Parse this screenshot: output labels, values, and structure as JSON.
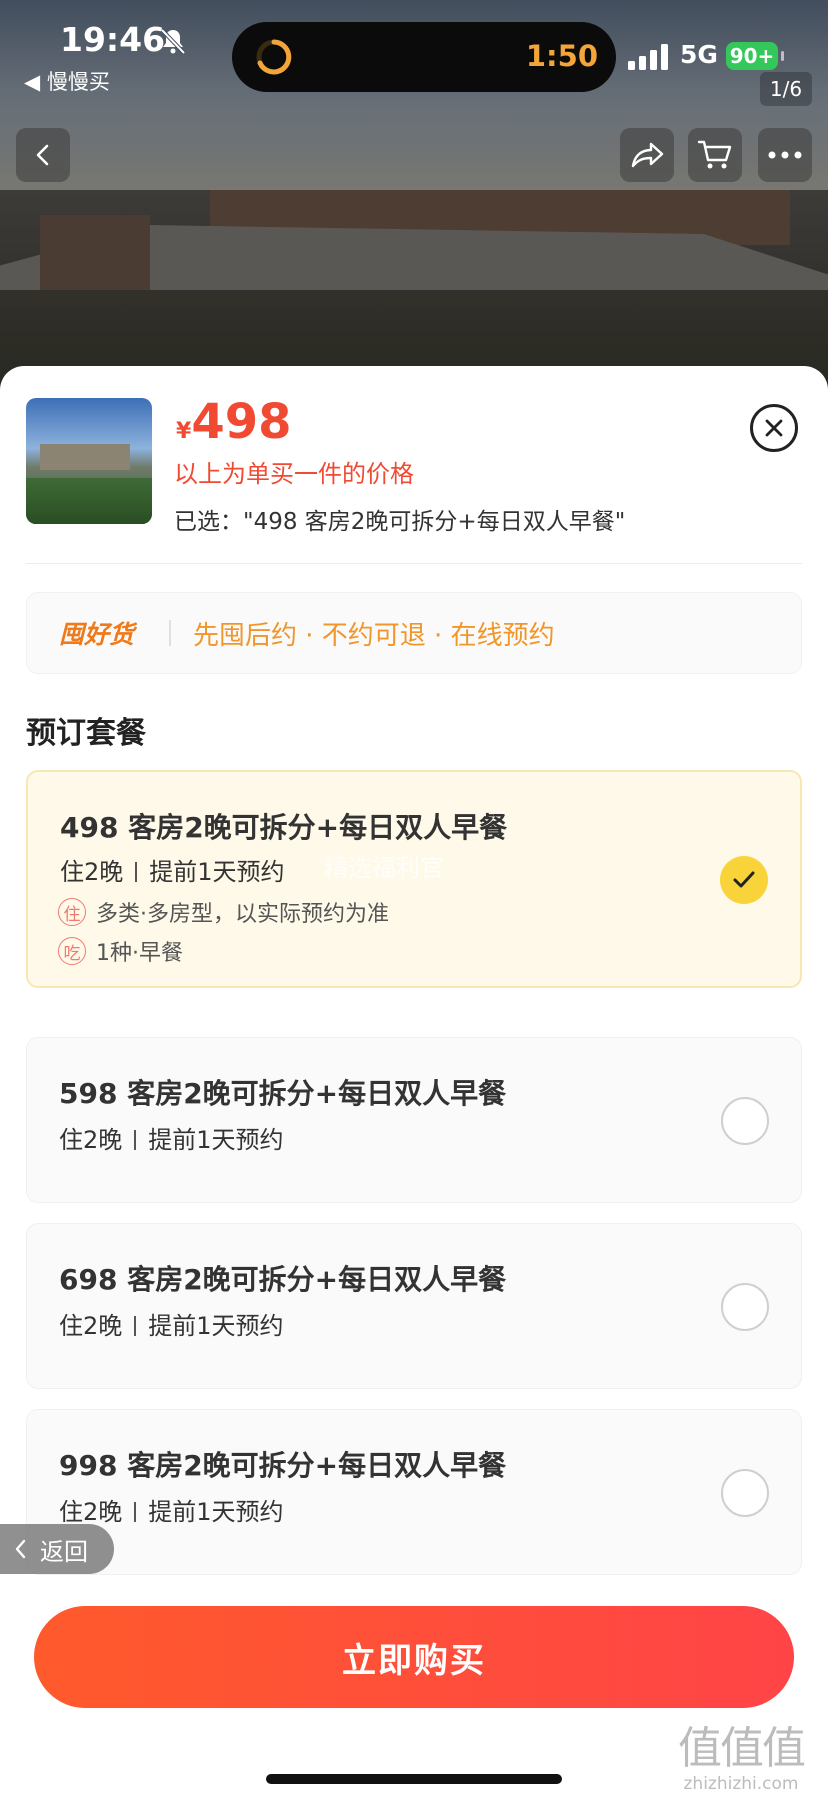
{
  "status_bar": {
    "time": "19:46",
    "back_app": "◀ 慢慢买",
    "island_timer": "1:50",
    "network": "5G",
    "battery": "90+"
  },
  "gallery": {
    "pager": "1/6"
  },
  "sheet": {
    "currency": "¥",
    "price": "498",
    "single_note": "以上为单买一件的价格",
    "selected_text": "已选：\"498 客房2晚可拆分+每日双人早餐\"",
    "promo": {
      "brand": "囤好货",
      "text": "先囤后约 · 不约可退 · 在线预约"
    },
    "section_title": "预订套餐",
    "watermark": "精选福利官",
    "packages": [
      {
        "title": "498 客房2晚可拆分+每日双人早餐",
        "nights": "住2晚",
        "advance": "提前1天预约",
        "selected": true,
        "tags": [
          {
            "badge": "住",
            "text": "多类·多房型，以实际预约为准"
          },
          {
            "badge": "吃",
            "text": "1种·早餐"
          }
        ]
      },
      {
        "title": "598 客房2晚可拆分+每日双人早餐",
        "nights": "住2晚",
        "advance": "提前1天预约",
        "selected": false
      },
      {
        "title": "698 客房2晚可拆分+每日双人早餐",
        "nights": "住2晚",
        "advance": "提前1天预约",
        "selected": false
      },
      {
        "title": "998 客房2晚可拆分+每日双人早餐",
        "nights": "住2晚",
        "advance": "提前1天预约",
        "selected": false
      }
    ],
    "back_label": "返回",
    "buy_label": "立即购买"
  },
  "site_mark": {
    "big": "值值值",
    "small": "zhizhizhi.com"
  },
  "colors": {
    "price_red": "#f04a32",
    "promo_orange": "#f0962a",
    "selected_bg": "#fff9e9",
    "check_yellow": "#f8d33a",
    "buy_gradient_start": "#ff5a2c",
    "buy_gradient_end": "#ff4447"
  }
}
